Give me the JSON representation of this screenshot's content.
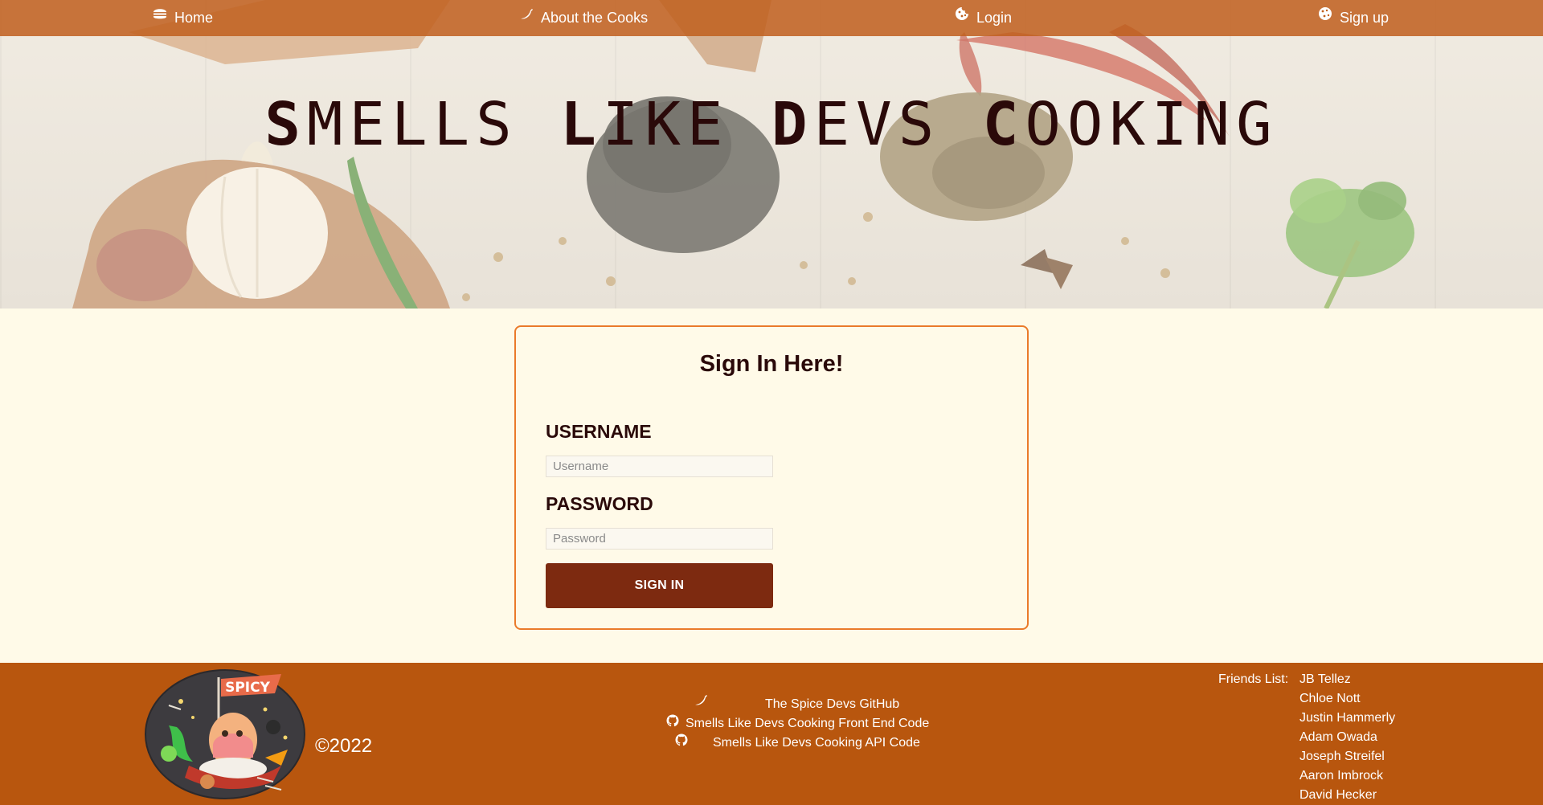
{
  "nav": {
    "items": [
      {
        "label": "Home",
        "icon": "burger-icon"
      },
      {
        "label": "About the Cooks",
        "icon": "chili-icon"
      },
      {
        "label": "Login",
        "icon": "cookie-icon"
      },
      {
        "label": "Sign up",
        "icon": "cookie-icon"
      }
    ]
  },
  "hero": {
    "title_parts": [
      {
        "cap": "S",
        "rest": "MELLS "
      },
      {
        "cap": "L",
        "rest": "IKE "
      },
      {
        "cap": "D",
        "rest": "EVS "
      },
      {
        "cap": "C",
        "rest": "OOKING"
      }
    ]
  },
  "signin": {
    "heading": "Sign In Here!",
    "username_label": "USERNAME",
    "username_placeholder": "Username",
    "password_label": "PASSWORD",
    "password_placeholder": "Password",
    "button_label": "SIGN IN"
  },
  "footer": {
    "logo_text": "SPICY",
    "copyright": "©2022",
    "links": [
      {
        "label": "The Spice Devs GitHub",
        "icon": "chili-icon"
      },
      {
        "label": "Smells Like Devs Cooking Front End Code",
        "icon": "github-icon"
      },
      {
        "label": "Smells Like Devs Cooking API Code",
        "icon": "github-icon"
      }
    ],
    "friends_label": "Friends List:",
    "friends": [
      "JB Tellez",
      "Chloe Nott",
      "Justin Hammerly",
      "Adam Owada",
      "Joseph Streifel",
      "Aaron Imbrock",
      "David Hecker"
    ]
  },
  "colors": {
    "nav_bg": "#c0601e",
    "page_bg": "#fffae8",
    "card_border": "#ea7a2a",
    "button_bg": "#7d2a10",
    "footer_bg": "#b8560e",
    "title_text": "#2a0909"
  }
}
